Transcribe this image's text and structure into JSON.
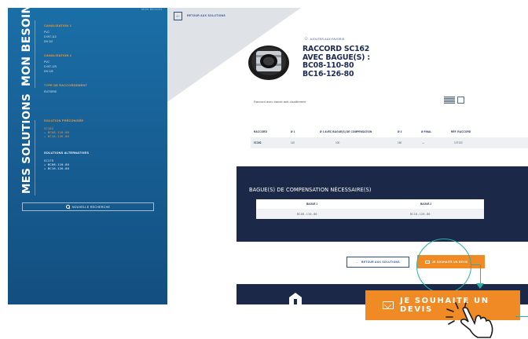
{
  "sidebar": {
    "top_line": "MON BESOIN",
    "besoin_label": "MON BESOIN",
    "solutions_label": "MES SOLUTIONS",
    "canalisation1": {
      "title": "CANALISATION 1",
      "lines": [
        "PVC",
        "D 097-110",
        "DN 110"
      ]
    },
    "canalisation2": {
      "title": "CANALISATION 2",
      "lines": [
        "PVC",
        "D 097-125",
        "DN 125"
      ]
    },
    "raccordement": {
      "title": "TYPE DE RACCORDEMENT",
      "value": "ENTERRE"
    },
    "preconisee": {
      "title": "SOLUTION PRÉCONISÉE",
      "codes": [
        "SC162",
        "+ BC08-110-80",
        "+ BC16-126-80"
      ]
    },
    "alternatives": {
      "title": "SOLUTIONS ALTERNATIVES",
      "codes": [
        "SC175",
        "+ BC08-110-80",
        "+ BC16-126-80"
      ]
    },
    "new_search": "NOUVELLE RECHERCHE"
  },
  "main": {
    "back_label": "RETOUR AUX SOLUTIONS",
    "fav_label": "AJOUTER AUX FAVORIS",
    "title_lines": [
      "RACCORD SC162",
      "AVEC BAGUE(S) :",
      "BC08-110-80",
      "BC16-126-80"
    ],
    "description": "Raccord avec bande anti-cisaillement",
    "table": {
      "headers": [
        "RACCORD",
        "Ø 1",
        "Ø 1 AVEC BAGUE(S) DE COMPENSATION",
        "Ø 2",
        "Ø FINAL",
        "RÉF. RACCORD"
      ],
      "row": [
        "SC162",
        "110",
        "100",
        "160",
        "—",
        "107102"
      ]
    },
    "bagues": {
      "title": "BAGUE(S) DE COMPENSATION NÉCESSAIRE(S)",
      "headers": [
        "BAGUE 1",
        "BAGUE 2"
      ],
      "values": [
        "BC08-110-80",
        "BC16-126-80"
      ]
    },
    "back_button": "RETOUR AUX SOLUTIONS",
    "devis_small": "JE SOUHAITE UN DEVIS"
  },
  "overlay": {
    "devis_big": "JE SOUHAITE UN DEVIS"
  },
  "colors": {
    "sidebar_blue": "#1a6fa7",
    "navy": "#1c2848",
    "orange": "#f08a24",
    "teal": "#27b0a8"
  }
}
